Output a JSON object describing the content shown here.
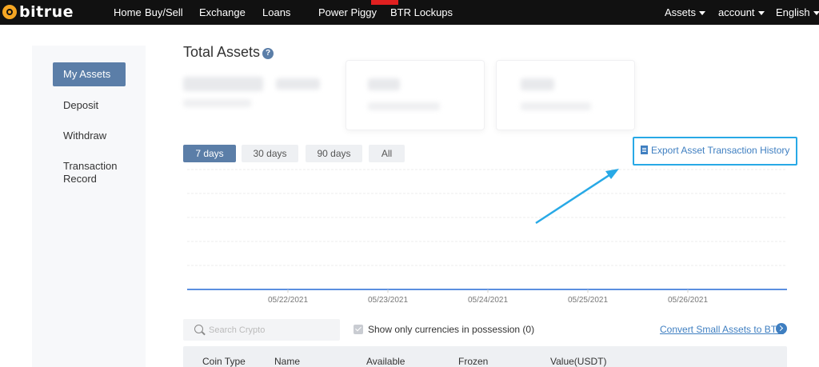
{
  "brand": {
    "name": "bitrue"
  },
  "nav": {
    "items": [
      "Home",
      "Buy/Sell",
      "Exchange",
      "Loans",
      "Power Piggy",
      "BTR Lockups"
    ],
    "right": [
      "Assets",
      "account",
      "English"
    ]
  },
  "sidebar": {
    "items": [
      "My Assets",
      "Deposit",
      "Withdraw",
      "Transaction Record"
    ]
  },
  "page": {
    "title": "Total Assets",
    "help": "?"
  },
  "ranges": {
    "items": [
      "7 days",
      "30 days",
      "90 days",
      "All"
    ],
    "active": "7 days"
  },
  "export": {
    "label": "Export Asset Transaction History"
  },
  "chart_data": {
    "type": "line",
    "x": [
      "05/22/2021",
      "05/23/2021",
      "05/24/2021",
      "05/25/2021",
      "05/26/2021"
    ],
    "grid": true,
    "legend": "none"
  },
  "search": {
    "placeholder": "Search Crypto"
  },
  "filter": {
    "label": "Show only currencies in possession (0)",
    "checked": true
  },
  "convert": {
    "label": "Convert Small Assets to BTR"
  },
  "table": {
    "headers": [
      "Coin Type",
      "Name",
      "Available",
      "Frozen",
      "Value(USDT)"
    ]
  },
  "colors": {
    "accent": "#5b7ea8",
    "highlight": "#28a9e6",
    "link": "#3f7fc1",
    "line": "#5b8fe0"
  }
}
